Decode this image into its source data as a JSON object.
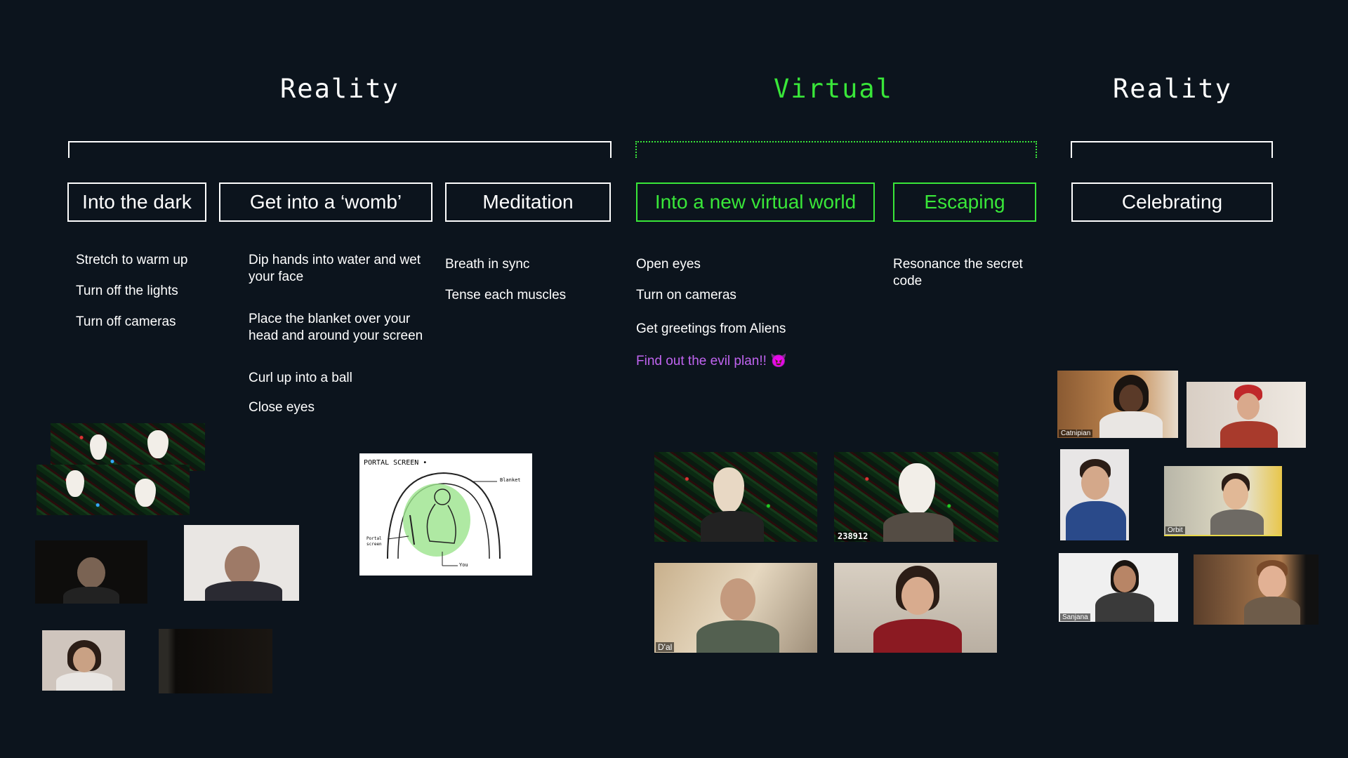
{
  "sections": [
    {
      "title": "Reality",
      "color": "#ffffff"
    },
    {
      "title": "Virtual",
      "color": "#39e639"
    },
    {
      "title": "Reality",
      "color": "#ffffff"
    }
  ],
  "stages": [
    {
      "label": "Into the dark"
    },
    {
      "label": "Get into a ‘womb’"
    },
    {
      "label": "Meditation"
    },
    {
      "label": "Into a new virtual world"
    },
    {
      "label": "Escaping"
    },
    {
      "label": "Celebrating"
    }
  ],
  "steps": {
    "into_the_dark": [
      "Stretch to warm up",
      "Turn off the lights",
      "Turn off cameras"
    ],
    "womb": [
      "Dip hands into water and wet your face",
      "Place the blanket over your head and around your screen",
      "Curl up into a ball",
      "Close eyes"
    ],
    "meditation": [
      "Breath in sync",
      "Tense each muscles"
    ],
    "virtual_world": [
      "Open eyes",
      "Turn on cameras",
      "Get greetings from Aliens",
      "Find out the evil plan!! 😈"
    ],
    "escaping": [
      "Resonance the secret code"
    ]
  },
  "sketch": {
    "title": "PORTAL SCREEN •",
    "label_blanket": "Blanket",
    "label_portal": "Portal screen",
    "label_you": "You"
  },
  "participant_tags": {
    "code": "238912",
    "dal": "D'al",
    "catnipian": "Catnipian",
    "orbit": "Orbit",
    "sanjana": "Sanjana"
  },
  "colors": {
    "background": "#0c141d",
    "virtual_green": "#39e639",
    "highlight_purple": "#c064f0"
  }
}
